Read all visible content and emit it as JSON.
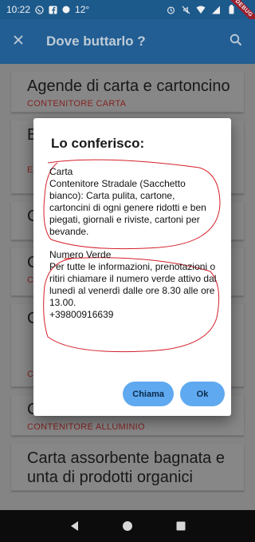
{
  "status_bar": {
    "time": "10:22",
    "extra": "12°",
    "debug_banner": "DEBUG"
  },
  "app_bar": {
    "title": "Dove buttarlo ?",
    "close_icon": "close-icon",
    "search_icon": "search-icon"
  },
  "list": {
    "items": [
      {
        "title": "Agende di carta e cartoncino",
        "subtitle": "CONTENITORE CARTA"
      },
      {
        "title": "B",
        "subtitle": "E"
      },
      {
        "title": "C",
        "subtitle": ""
      },
      {
        "title": "C",
        "subtitle": "C"
      },
      {
        "title": "C",
        "subtitle": "C"
      },
      {
        "title": "Carta alluminio",
        "subtitle": "CONTENITORE ALLUMINIO"
      },
      {
        "title": "Carta assorbente bagnata e unta di prodotti organici",
        "subtitle": ""
      }
    ]
  },
  "dialog": {
    "title": "Lo conferisco:",
    "block1": "Carta\nContenitore Stradale (Sacchetto bianco): Carta pulita, cartone, cartoncini di ogni genere ridotti e ben piegati, giornali e riviste, cartoni per bevande.",
    "block2": "Numero Verde\nPer tutte le informazioni, prenotazioni o ritiri chiamare il numero verde attivo dal lunedì al venerdì dalle ore 8.30 alle ore 13.00.\n+39800916639",
    "call_label": "Chiama",
    "ok_label": "Ok",
    "annotation_color": "#d4202a"
  },
  "colors": {
    "app_bar": "#24649b",
    "accent_button": "#5fa9f0",
    "subtitle_red": "#8b2525"
  }
}
